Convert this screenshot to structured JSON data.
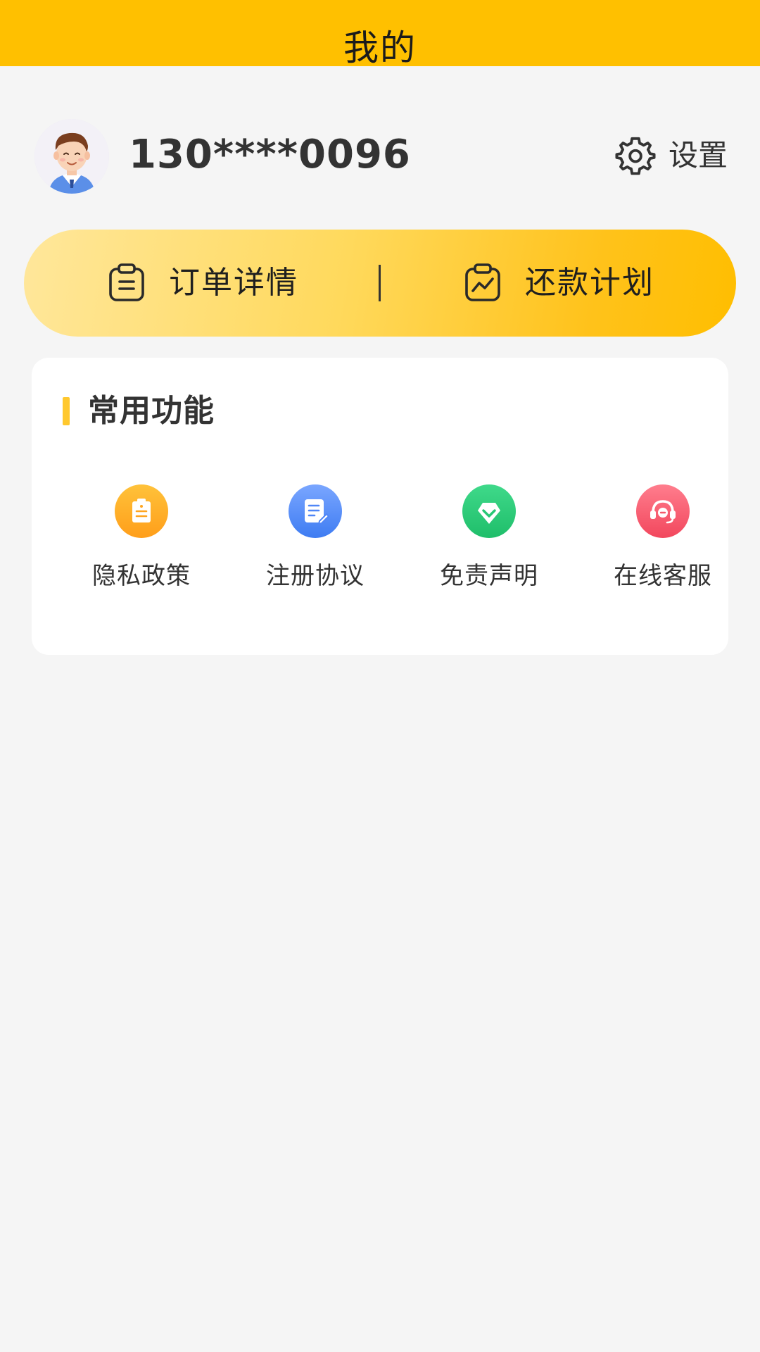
{
  "header": {
    "title": "我的"
  },
  "profile": {
    "phone": "130****0096",
    "avatar_icon": "avatar-icon",
    "settings_label": "设置",
    "settings_icon": "gear-icon"
  },
  "actions": {
    "orders": {
      "label": "订单详情",
      "icon": "clipboard-icon"
    },
    "plan": {
      "label": "还款计划",
      "icon": "chart-icon"
    }
  },
  "functions": {
    "title": "常用功能",
    "items": [
      {
        "label": "隐私政策",
        "icon": "clipboard-icon",
        "color": "#FFA520"
      },
      {
        "label": "注册协议",
        "icon": "document-edit-icon",
        "color": "#4F86F7"
      },
      {
        "label": "免责声明",
        "icon": "diamond-icon",
        "color": "#27C774"
      },
      {
        "label": "在线客服",
        "icon": "headset-icon",
        "color": "#F45A6C"
      }
    ]
  },
  "colors": {
    "accent": "#FFC000",
    "background": "#F5F5F5"
  }
}
